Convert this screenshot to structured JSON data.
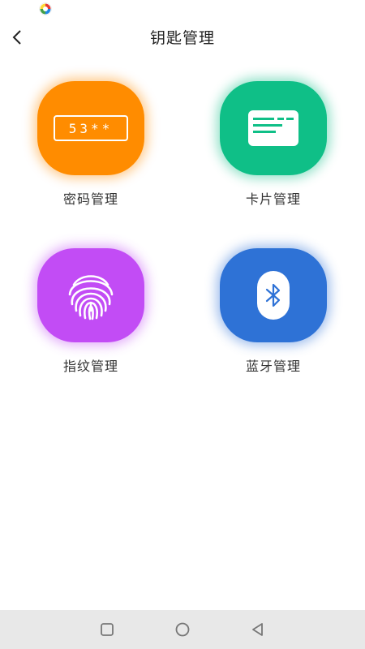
{
  "header": {
    "title": "钥匙管理",
    "back_icon": "back-arrow-icon"
  },
  "tiles": [
    {
      "label": "密码管理",
      "icon": "password-icon",
      "code_text": "53**",
      "color": "#ff8c00"
    },
    {
      "label": "卡片管理",
      "icon": "card-icon",
      "color": "#0fbf87"
    },
    {
      "label": "指纹管理",
      "icon": "fingerprint-icon",
      "color": "#c24cf5"
    },
    {
      "label": "蓝牙管理",
      "icon": "bluetooth-icon",
      "color": "#2e72d6"
    }
  ],
  "nav_bar": {
    "icons": [
      "recents-square-icon",
      "home-circle-icon",
      "back-triangle-icon"
    ]
  }
}
